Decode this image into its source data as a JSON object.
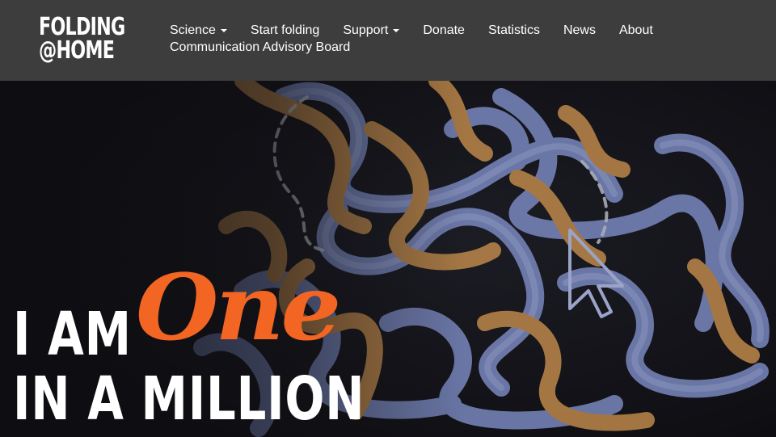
{
  "site": {
    "logo_line1": "FOLDING",
    "logo_line2": "@HOME"
  },
  "nav": {
    "items": [
      {
        "label": "Science",
        "dropdown": true
      },
      {
        "label": "Start folding",
        "dropdown": false
      },
      {
        "label": "Support",
        "dropdown": true
      },
      {
        "label": "Donate",
        "dropdown": false
      },
      {
        "label": "Statistics",
        "dropdown": false
      },
      {
        "label": "News",
        "dropdown": false
      },
      {
        "label": "About",
        "dropdown": false
      },
      {
        "label": "Communication Advisory Board",
        "dropdown": false
      }
    ]
  },
  "hero": {
    "line1": "I AM",
    "highlight": "One",
    "line2": "IN A MILLION",
    "accent_color": "#f26522",
    "background": "protein-strands-image",
    "cursor_icon": "arrow-cursor-icon"
  },
  "colors": {
    "navbar": "#3d3d3d",
    "strand_blue": "#8090c8",
    "strand_orange": "#c89050"
  }
}
